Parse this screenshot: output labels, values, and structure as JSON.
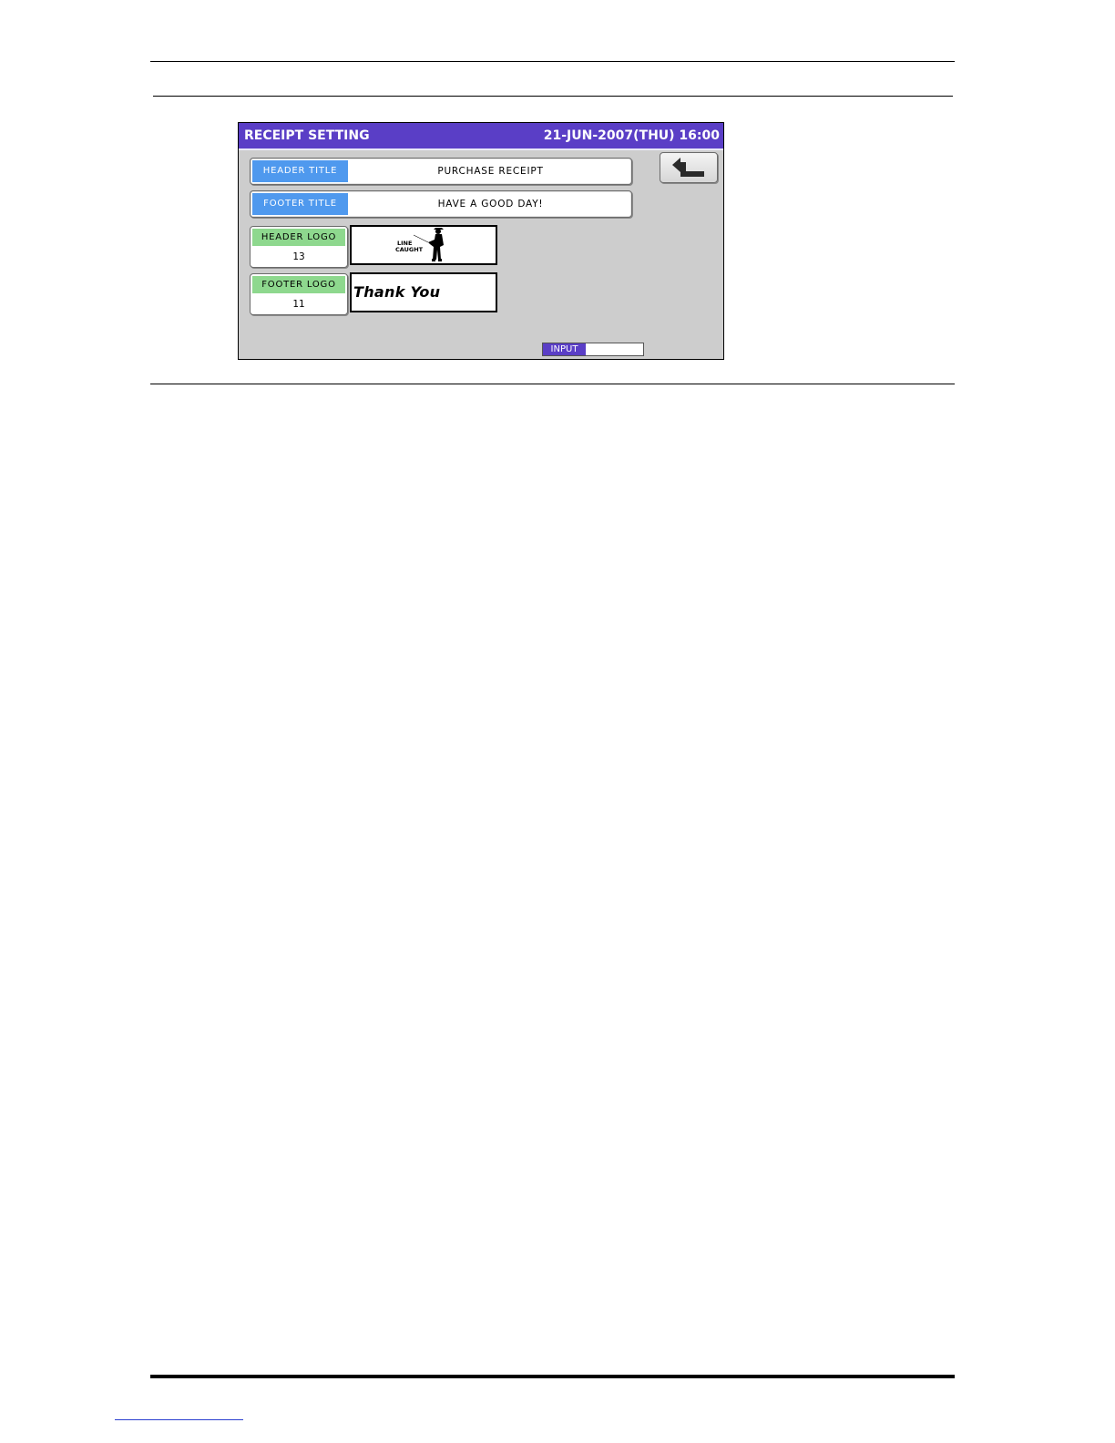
{
  "window": {
    "title": "RECEIPT SETTING",
    "datetime": "21-JUN-2007(THU)  16:00"
  },
  "fields": {
    "header_title": {
      "label": "HEADER TITLE",
      "value": "PURCHASE RECEIPT"
    },
    "footer_title": {
      "label": "FOOTER TITLE",
      "value": "HAVE A GOOD DAY!"
    }
  },
  "logos": {
    "header": {
      "label": "HEADER LOGO",
      "number": "13",
      "image_text_line1": "LINE",
      "image_text_line2": "CAUGHT"
    },
    "footer": {
      "label": "FOOTER LOGO",
      "number": "11",
      "image_text": "Thank You"
    }
  },
  "input": {
    "label": "INPUT",
    "value": ""
  },
  "icons": {
    "back": "return-arrow-icon"
  },
  "colors": {
    "title_bar": "#5a3ec6",
    "title_label": "#4f99ee",
    "logo_label": "#8ed88e",
    "screen_bg": "#cdcdcd"
  }
}
